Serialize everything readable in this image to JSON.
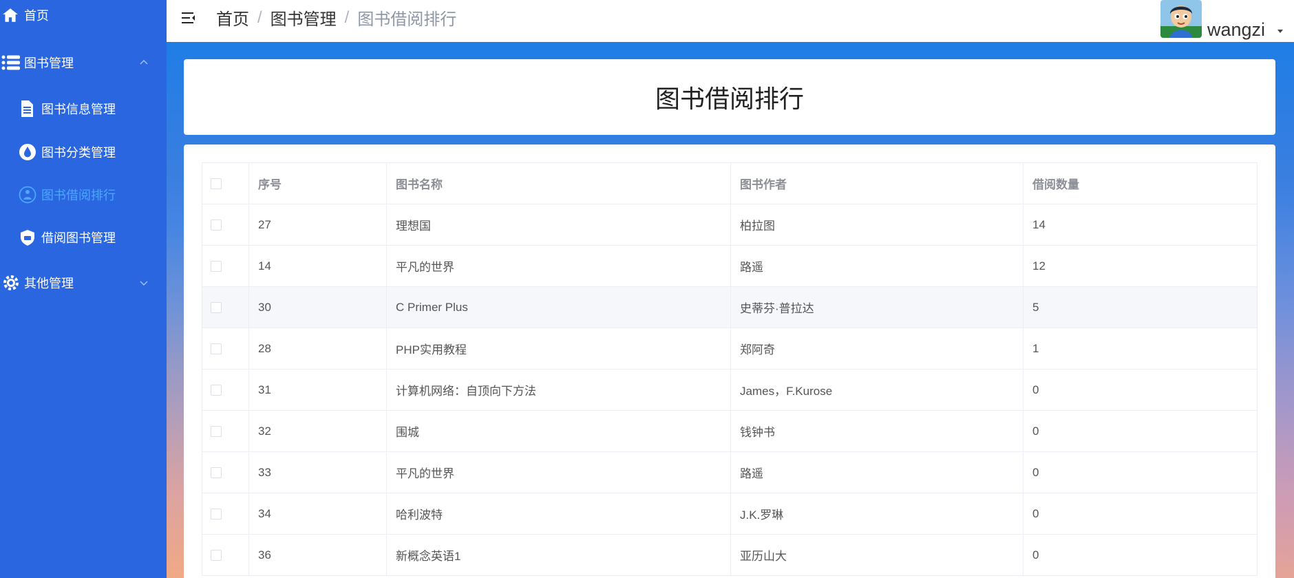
{
  "sidebar": {
    "items": [
      {
        "label": "首页",
        "icon": "home-icon"
      },
      {
        "label": "图书管理",
        "icon": "list-icon",
        "expanded": true
      },
      {
        "label": "图书信息管理",
        "icon": "document-icon"
      },
      {
        "label": "图书分类管理",
        "icon": "drop-icon"
      },
      {
        "label": "图书借阅排行",
        "icon": "users-icon",
        "active": true
      },
      {
        "label": "借阅图书管理",
        "icon": "shield-icon"
      },
      {
        "label": "其他管理",
        "icon": "gear-icon",
        "expanded": false
      }
    ],
    "bg_color": "#2a66e0",
    "active_color": "#4aa8ff"
  },
  "header": {
    "breadcrumb": [
      "首页",
      "图书管理",
      "图书借阅排行"
    ],
    "username": "wangzi"
  },
  "page_title": "图书借阅排行",
  "table": {
    "columns": [
      "序号",
      "图书名称",
      "图书作者",
      "借阅数量"
    ],
    "rows": [
      {
        "id": "27",
        "name": "理想国",
        "author": "柏拉图",
        "count": "14"
      },
      {
        "id": "14",
        "name": "平凡的世界",
        "author": "路遥",
        "count": "12"
      },
      {
        "id": "30",
        "name": "C Primer Plus",
        "author": "史蒂芬·普拉达",
        "count": "5"
      },
      {
        "id": "28",
        "name": "PHP实用教程",
        "author": "郑阿奇",
        "count": "1"
      },
      {
        "id": "31",
        "name": "计算机网络：自顶向下方法",
        "author": "James，F.Kurose",
        "count": "0"
      },
      {
        "id": "32",
        "name": "围城",
        "author": "钱钟书",
        "count": "0"
      },
      {
        "id": "33",
        "name": "平凡的世界",
        "author": "路遥",
        "count": "0"
      },
      {
        "id": "34",
        "name": "哈利波特",
        "author": "J.K.罗琳",
        "count": "0"
      },
      {
        "id": "36",
        "name": "新概念英语1",
        "author": "亚历山大",
        "count": "0"
      }
    ]
  }
}
